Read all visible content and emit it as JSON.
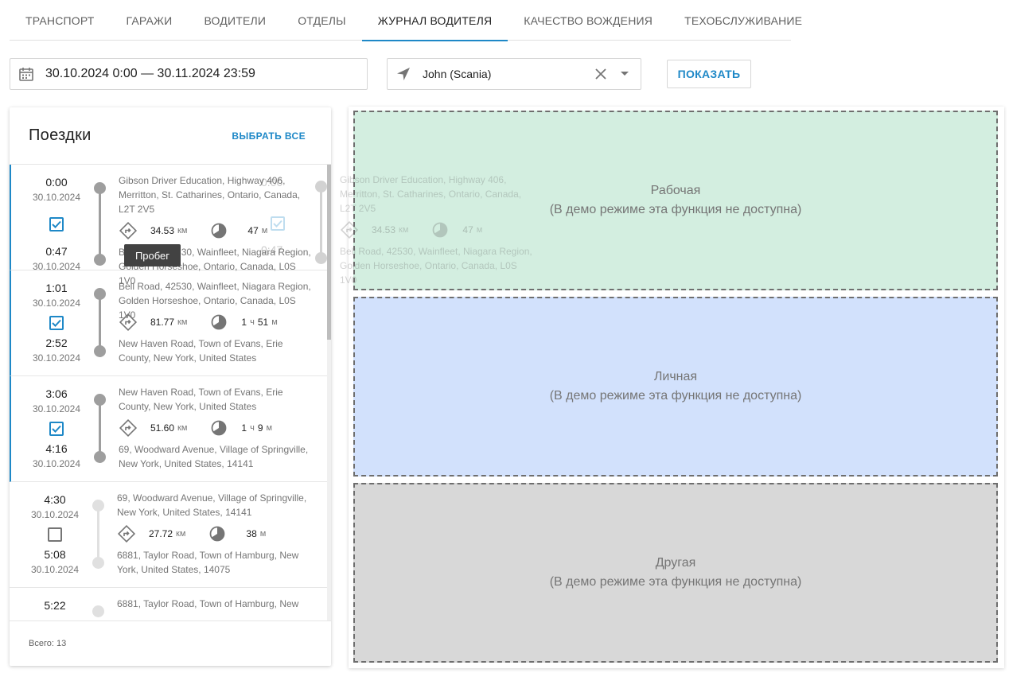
{
  "tabs": [
    {
      "label": "ТРАНСПОРТ",
      "active": false
    },
    {
      "label": "ГАРАЖИ",
      "active": false
    },
    {
      "label": "ВОДИТЕЛИ",
      "active": false
    },
    {
      "label": "ОТДЕЛЫ",
      "active": false
    },
    {
      "label": "ЖУРНАЛ ВОДИТЕЛЯ",
      "active": true
    },
    {
      "label": "КАЧЕСТВО ВОЖДЕНИЯ",
      "active": false
    },
    {
      "label": "ТЕХОБСЛУЖИВАНИЕ",
      "active": false
    }
  ],
  "filters": {
    "date_range": "30.10.2024 0:00 — 30.11.2024 23:59",
    "vehicle": "John (Scania)",
    "show_button": "ПОКАЗАТЬ"
  },
  "trips_panel": {
    "title": "Поездки",
    "select_all": "ВЫБРАТЬ ВСЕ",
    "total": "Всего: 13",
    "tooltip": "Пробег",
    "trips": [
      {
        "start_time": "0:00",
        "start_date": "30.10.2024",
        "end_time": "0:47",
        "end_date": "30.10.2024",
        "checked": true,
        "from": "Gibson Driver Education, Highway 406, Merritton, St. Catharines, Ontario, Canada, L2T 2V5",
        "distance": "34.53",
        "distance_unit": "км",
        "duration_h": "",
        "duration_h_unit": "",
        "duration_m": "47",
        "duration_m_unit": "м",
        "to": "Bell Road, 42530, Wainfleet, Niagara Region, Golden Horseshoe, Ontario, Canada, L0S 1V0"
      },
      {
        "start_time": "1:01",
        "start_date": "30.10.2024",
        "end_time": "2:52",
        "end_date": "30.10.2024",
        "checked": true,
        "from": "Bell Road, 42530, Wainfleet, Niagara Region, Golden Horseshoe, Ontario, Canada, L0S 1V0",
        "distance": "81.77",
        "distance_unit": "км",
        "duration_h": "1",
        "duration_h_unit": "ч",
        "duration_m": "51",
        "duration_m_unit": "м",
        "to": "New Haven Road, Town of Evans, Erie County, New York, United States"
      },
      {
        "start_time": "3:06",
        "start_date": "30.10.2024",
        "end_time": "4:16",
        "end_date": "30.10.2024",
        "checked": true,
        "from": "New Haven Road, Town of Evans, Erie County, New York, United States",
        "distance": "51.60",
        "distance_unit": "км",
        "duration_h": "1",
        "duration_h_unit": "ч",
        "duration_m": "9",
        "duration_m_unit": "м",
        "to": "69, Woodward Avenue, Village of Springville, New York, United States, 14141"
      },
      {
        "start_time": "4:30",
        "start_date": "30.10.2024",
        "end_time": "5:08",
        "end_date": "30.10.2024",
        "checked": false,
        "from": "69, Woodward Avenue, Village of Springville, New York, United States, 14141",
        "distance": "27.72",
        "distance_unit": "км",
        "duration_h": "",
        "duration_h_unit": "",
        "duration_m": "38",
        "duration_m_unit": "м",
        "to": "6881, Taylor Road, Town of Hamburg, New York, United States, 14075"
      },
      {
        "start_time": "5:22",
        "start_date": "",
        "end_time": "",
        "end_date": "",
        "checked": false,
        "from": "6881, Taylor Road, Town of Hamburg, New",
        "distance": "",
        "distance_unit": "",
        "duration_h": "",
        "duration_h_unit": "",
        "duration_m": "",
        "duration_m_unit": "",
        "to": ""
      }
    ]
  },
  "drag_ghost": {
    "time_top": "0:00",
    "time_bottom": "0:47",
    "from": "Gibson Driver Education, Highway 406, Merritton, St. Catharines, Ontario, Canada, L2T 2V5",
    "distance": "34.53",
    "distance_unit": "км",
    "duration": "47",
    "duration_unit": "м",
    "to": "Bell Road, 42530, Wainfleet, Niagara Region, Golden Horseshoe, Ontario, Canada, L0S 1V0"
  },
  "zones": [
    {
      "title": "Рабочая",
      "note": "(В демо режиме эта функция не доступна)",
      "color": "#d3eee0"
    },
    {
      "title": "Личная",
      "note": "(В демо режиме эта функция не доступна)",
      "color": "#d2e1fc"
    },
    {
      "title": "Другая",
      "note": "(В демо режиме эта функция не доступна)",
      "color": "#d8d8d8"
    }
  ],
  "colors": {
    "accent": "#1e88c7",
    "text": "#212121",
    "muted": "#757575"
  },
  "icons": [
    "calendar-icon",
    "navigation-arrow-icon",
    "close-icon",
    "dropdown-caret-icon",
    "checkbox-checked-icon",
    "checkbox-empty-icon",
    "route-distance-icon",
    "duration-clock-icon"
  ]
}
